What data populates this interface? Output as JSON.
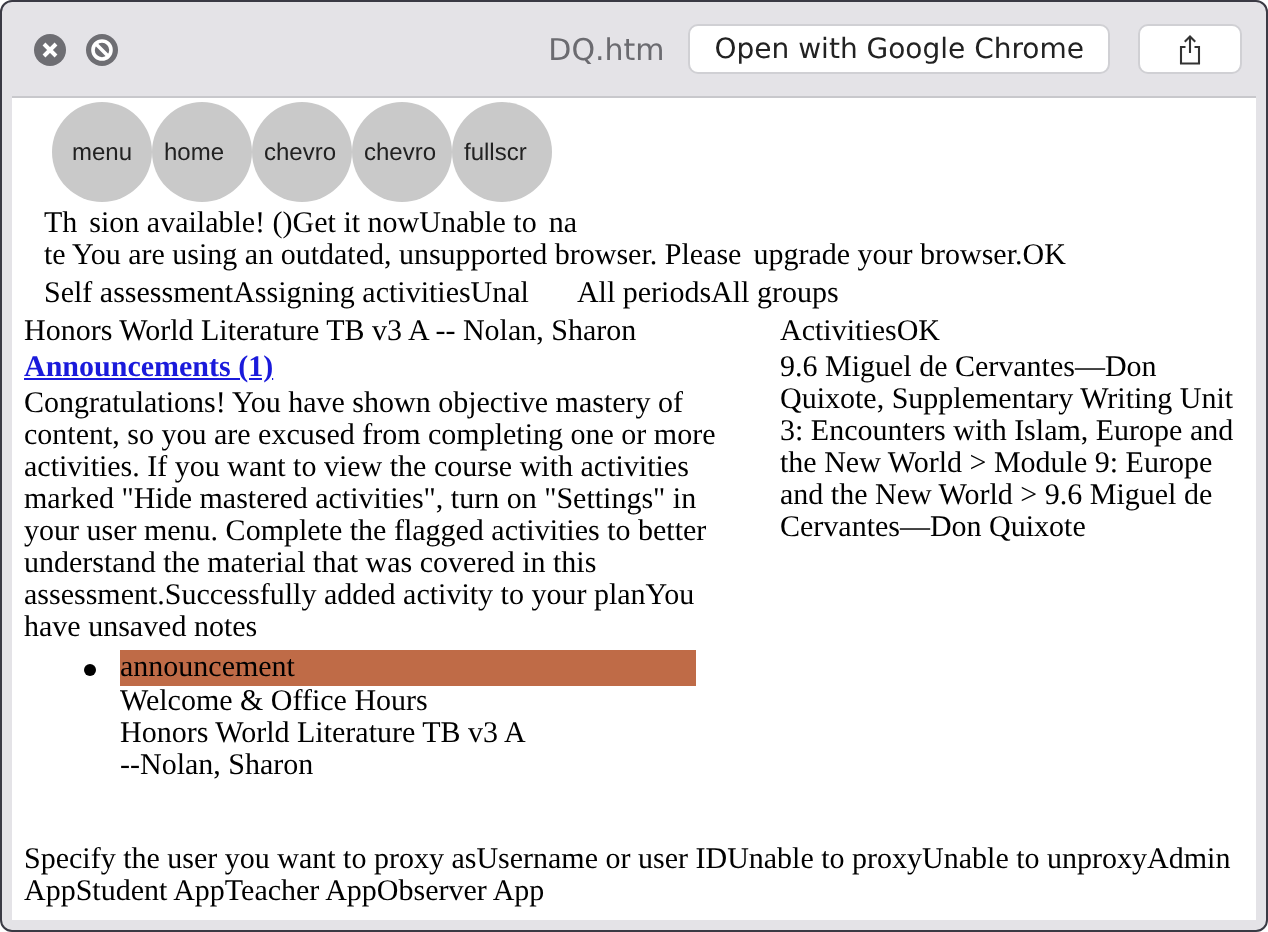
{
  "window": {
    "title": "DQ.htm",
    "open_button": "Open with Google Chrome"
  },
  "nav_buttons": [
    {
      "label": "menu"
    },
    {
      "label": "home"
    },
    {
      "label": "chevro"
    },
    {
      "label": "chevro"
    },
    {
      "label": "fullscr"
    }
  ],
  "update_notice": [
    "Th",
    "sion available! ()Get it nowUnable to",
    "na",
    "te You are using an outdated, unsupported browser. Please",
    "upgrade your browser.OK"
  ],
  "self_assessment": "Self assessmentAssigning activitiesUnal",
  "filters": "All periodsAll groups",
  "course_heading": "Honors World Literature TB v3 A -- Nolan, Sharon",
  "activities_label": "ActivitiesOK",
  "breadcrumb": "9.6 Miguel de Cervantes—Don Quixote, Supplementary Writing Unit 3: Encounters with Islam, Europe and the New World > Module 9: Europe and the New World > 9.6 Miguel de Cervantes—Don Quixote",
  "announcements_link": "Announcements (1)",
  "mastery_message": "Congratulations! You have shown objective mastery of content, so you are excused from completing one or more activities. If you want to view the course with activities marked \"Hide mastered activities\", turn on \"Settings\" in your user menu. Complete the flagged activities to better understand the material that was covered in this assessment.Successfully added activity to your planYou have unsaved notes",
  "announcements": [
    {
      "tag": "announcement",
      "title": "Welcome & Office Hours",
      "course": "Honors World Literature TB v3 A",
      "teacher": "--Nolan, Sharon"
    }
  ],
  "proxy_text": "Specify the user you want to proxy asUsername or user IDUnable to proxyUnable to unproxyAdmin AppStudent AppTeacher AppObserver App"
}
